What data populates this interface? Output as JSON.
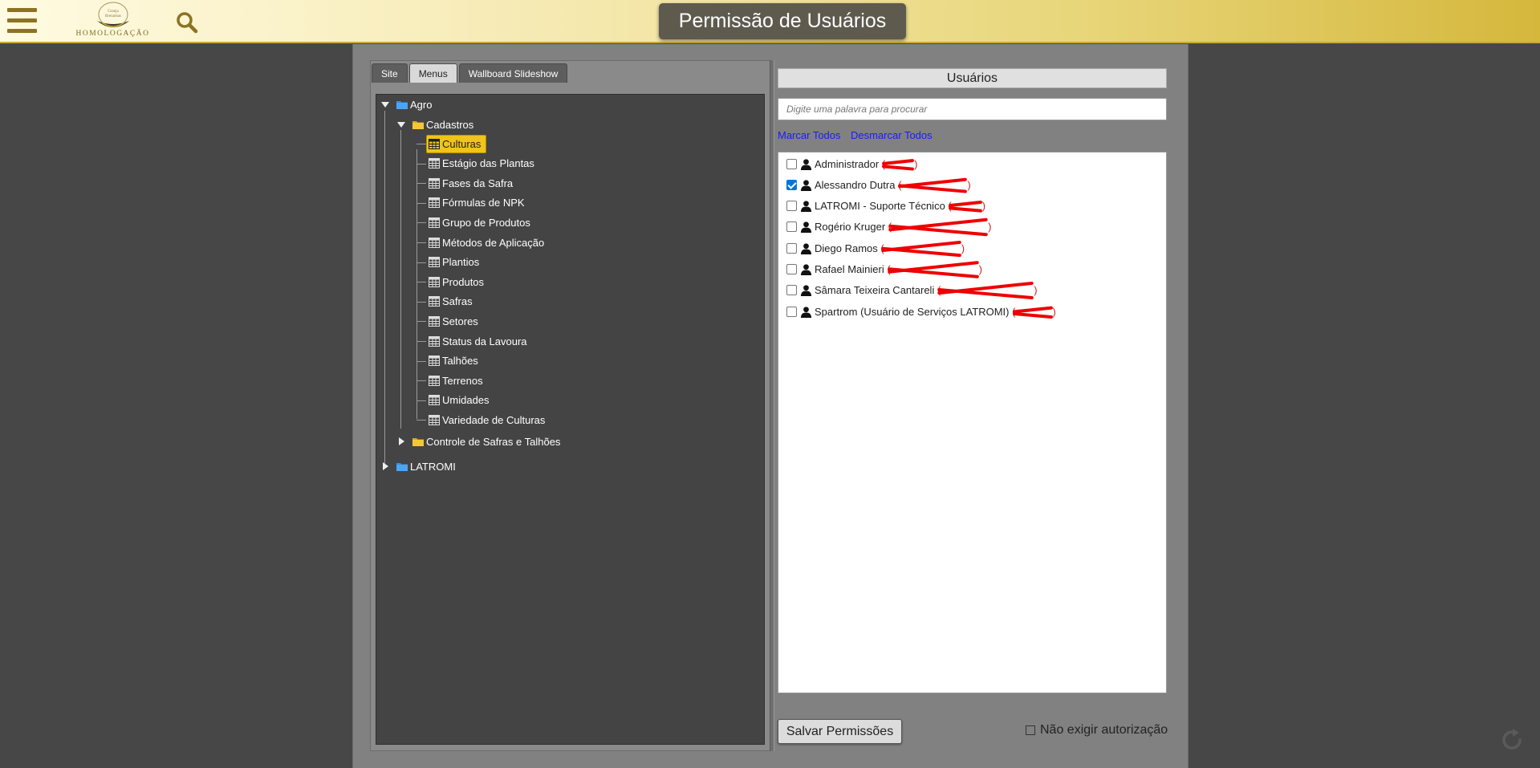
{
  "header": {
    "title": "Permissão de Usuários",
    "logo_text": "HOMOLOGAÇÃO",
    "logo_emblem_text": "Granja Bretanhas",
    "menu_icon": "hamburger-menu-icon",
    "search_icon": "magnifier-search-icon",
    "accent_color": "#d5b73c"
  },
  "tabs": [
    {
      "label": "Site",
      "active": false
    },
    {
      "label": "Menus",
      "active": true
    },
    {
      "label": "Wallboard Slideshow",
      "active": false
    }
  ],
  "tree": {
    "root1": {
      "label": "Agro",
      "expanded": true
    },
    "folder1": {
      "label": "Cadastros",
      "expanded": true
    },
    "items": [
      {
        "label": "Culturas",
        "selected": true
      },
      {
        "label": "Estágio das Plantas"
      },
      {
        "label": "Fases da Safra"
      },
      {
        "label": "Fórmulas de NPK"
      },
      {
        "label": "Grupo de Produtos"
      },
      {
        "label": "Métodos de Aplicação"
      },
      {
        "label": "Plantios"
      },
      {
        "label": "Produtos"
      },
      {
        "label": "Safras"
      },
      {
        "label": "Setores"
      },
      {
        "label": "Status da Lavoura"
      },
      {
        "label": "Talhões"
      },
      {
        "label": "Terrenos"
      },
      {
        "label": "Umidades"
      },
      {
        "label": "Variedade de Culturas"
      }
    ],
    "folder2": {
      "label": "Controle de Safras e Talhões",
      "expanded": false
    },
    "root2": {
      "label": "LATROMI",
      "expanded": false
    }
  },
  "users_panel": {
    "header": "Usuários",
    "search_placeholder": "Digite uma palavra para procurar",
    "select_all": "Marcar Todos",
    "deselect_all": "Desmarcar Todos",
    "users": [
      {
        "name": "Administrador",
        "checked": false
      },
      {
        "name": "Alessandro Dutra",
        "checked": true
      },
      {
        "name": "LATROMI - Suporte Técnico",
        "checked": false
      },
      {
        "name": "Rogério Kruger",
        "checked": false
      },
      {
        "name": "Diego Ramos",
        "checked": false
      },
      {
        "name": "Rafael Mainieri",
        "checked": false
      },
      {
        "name": "Sâmara Teixeira Cantareli",
        "checked": false
      },
      {
        "name": "Spartrom (Usuário de Serviços LATROMI)",
        "checked": false
      }
    ],
    "save_button": "Salvar Permissões",
    "no_auth_label": "Não exigir autorização",
    "no_auth_checked": false
  }
}
